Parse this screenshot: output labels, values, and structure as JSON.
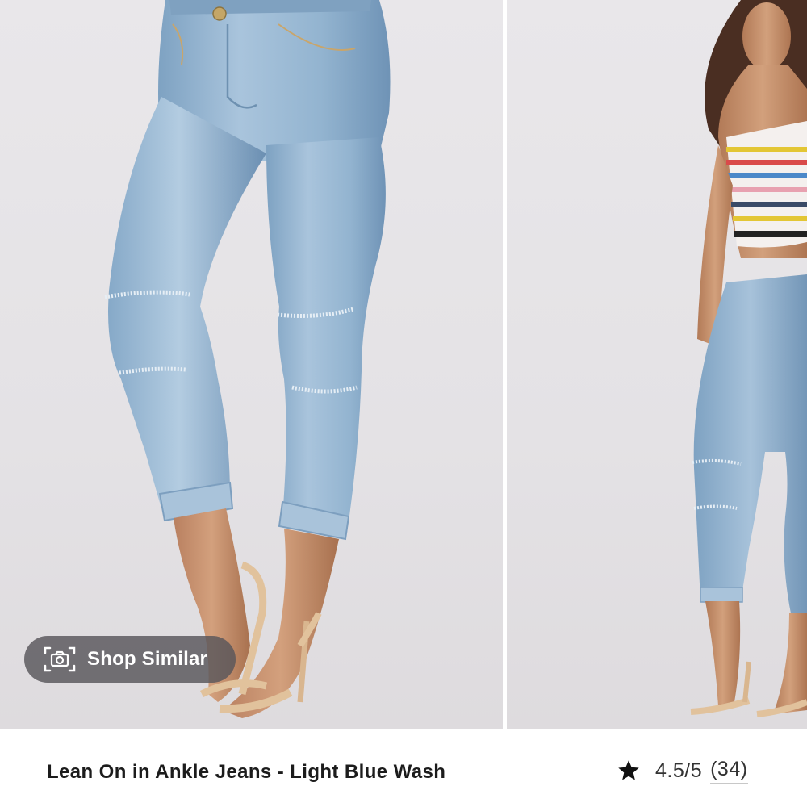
{
  "gallery": {
    "images": [
      {
        "alt": "Lean On in Ankle Jeans - Light Blue Wash"
      },
      {
        "alt": "Lean On in Ankle Jeans - Light Blue Wash"
      }
    ],
    "shop_similar_label": "Shop Similar",
    "shop_similar_icon": "camera-icon"
  },
  "product": {
    "title": "Lean On in Ankle Jeans - Light Blue Wash",
    "rating_icon": "star-icon",
    "rating": "4.5/5",
    "review_count": "(34)"
  },
  "colors": {
    "text": "#1c1c1c",
    "denim": "#8fb2cf",
    "overlay": "#58565a"
  }
}
